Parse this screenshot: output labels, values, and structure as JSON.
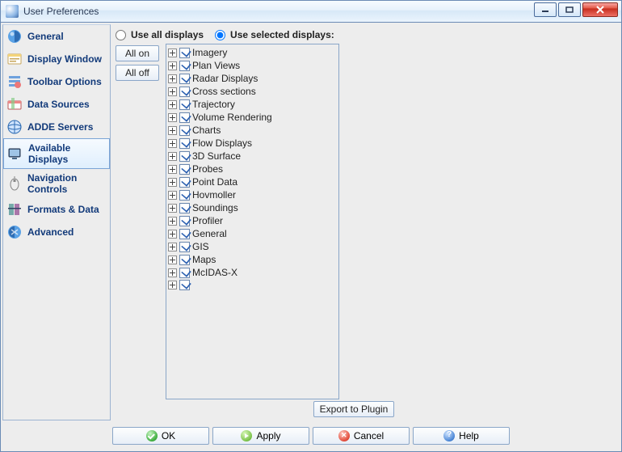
{
  "window": {
    "title": "User Preferences"
  },
  "sidebar": {
    "items": [
      {
        "label": "General",
        "icon": "general-icon",
        "selected": false
      },
      {
        "label": "Display Window",
        "icon": "display-window-icon",
        "selected": false
      },
      {
        "label": "Toolbar Options",
        "icon": "toolbar-options-icon",
        "selected": false
      },
      {
        "label": "Data Sources",
        "icon": "data-sources-icon",
        "selected": false
      },
      {
        "label": "ADDE Servers",
        "icon": "adde-servers-icon",
        "selected": false
      },
      {
        "label": "Available Displays",
        "icon": "available-displays-icon",
        "selected": true
      },
      {
        "label": "Navigation Controls",
        "icon": "navigation-controls-icon",
        "selected": false
      },
      {
        "label": "Formats & Data",
        "icon": "formats-data-icon",
        "selected": false
      },
      {
        "label": "Advanced",
        "icon": "advanced-icon",
        "selected": false
      }
    ]
  },
  "main": {
    "radio": {
      "use_all": "Use all displays",
      "use_selected": "Use selected displays:",
      "selected_value": "use_selected"
    },
    "all_on_label": "All on",
    "all_off_label": "All off",
    "tree": [
      {
        "label": "Imagery",
        "expandable": true,
        "checked": true
      },
      {
        "label": "Plan Views",
        "expandable": true,
        "checked": true
      },
      {
        "label": "Radar Displays",
        "expandable": true,
        "checked": true
      },
      {
        "label": "Cross sections",
        "expandable": true,
        "checked": true
      },
      {
        "label": "Trajectory",
        "expandable": true,
        "checked": true
      },
      {
        "label": "Volume Rendering",
        "expandable": true,
        "checked": true
      },
      {
        "label": "Charts",
        "expandable": true,
        "checked": true
      },
      {
        "label": "Flow Displays",
        "expandable": true,
        "checked": true
      },
      {
        "label": "3D Surface",
        "expandable": true,
        "checked": true
      },
      {
        "label": "Probes",
        "expandable": true,
        "checked": true
      },
      {
        "label": "Point Data",
        "expandable": true,
        "checked": true
      },
      {
        "label": "Hovmoller",
        "expandable": true,
        "checked": true
      },
      {
        "label": "Soundings",
        "expandable": true,
        "checked": true
      },
      {
        "label": "Profiler",
        "expandable": true,
        "checked": true
      },
      {
        "label": "General",
        "expandable": true,
        "checked": true
      },
      {
        "label": "GIS",
        "expandable": true,
        "checked": true
      },
      {
        "label": "Maps",
        "expandable": true,
        "checked": true
      },
      {
        "label": "McIDAS-X",
        "expandable": true,
        "checked": true
      },
      {
        "label": "",
        "expandable": true,
        "checked": true
      }
    ],
    "export_label": "Export to Plugin"
  },
  "buttons": {
    "ok": "OK",
    "apply": "Apply",
    "cancel": "Cancel",
    "help": "Help"
  }
}
